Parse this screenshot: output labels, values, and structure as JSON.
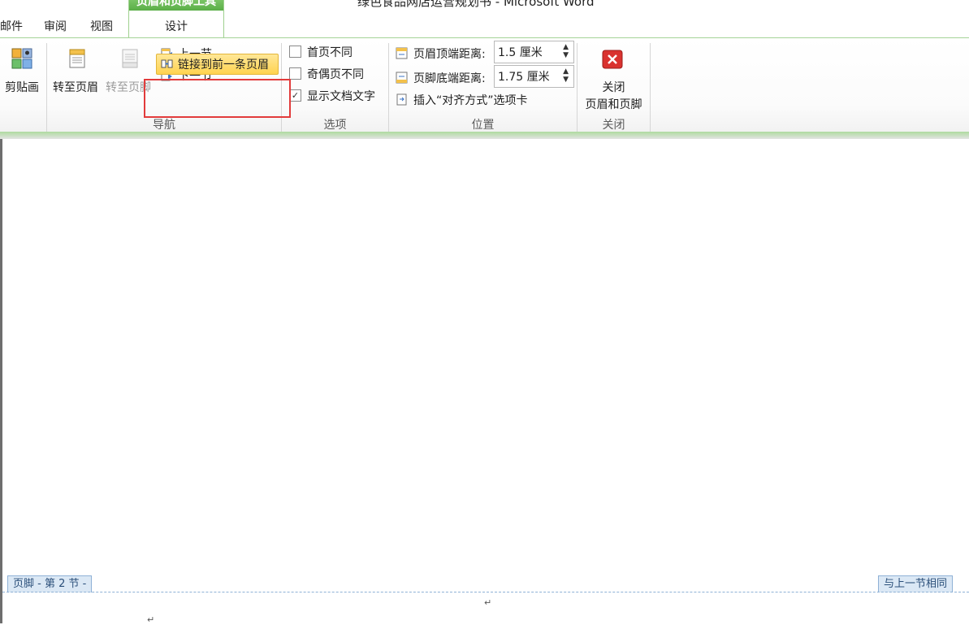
{
  "window": {
    "title": "绿色食品网店运营规划书 - Microsoft Word"
  },
  "tabs": {
    "mailings_partial": "邮件",
    "review": "审阅",
    "view": "视图",
    "context_group": "页眉和页脚工具",
    "design": "设计"
  },
  "ribbon": {
    "clipboard": {
      "partial_label": "剪贴画"
    },
    "navigation": {
      "goto_header": "转至页眉",
      "goto_footer": "转至页脚",
      "previous_section": "上一节",
      "next_section": "下一节",
      "link_to_previous": "链接到前一条页眉",
      "group_label": "导航"
    },
    "options": {
      "different_first_page": "首页不同",
      "different_odd_even": "奇偶页不同",
      "show_document_text": "显示文档文字",
      "show_document_text_checked": true,
      "group_label": "选项"
    },
    "position": {
      "header_top_label": "页眉顶端距离:",
      "header_top_value": "1.5 厘米",
      "footer_bottom_label": "页脚底端距离:",
      "footer_bottom_value": "1.75 厘米",
      "insert_alignment_tab": "插入“对齐方式”选项卡",
      "group_label": "位置"
    },
    "close": {
      "close_line1": "关闭",
      "close_line2": "页眉和页脚",
      "group_label": "关闭"
    }
  },
  "document": {
    "footer_tag": "页脚 - 第 2 节 -",
    "same_as_previous": "与上一节相同",
    "paragraph_mark": "↵"
  },
  "colors": {
    "context_green": "#5aae47",
    "highlight_red": "#e23b3b",
    "button_yellow": "#ffd34f",
    "close_red": "#d9322f",
    "tag_blue": "#dbe8f5"
  }
}
